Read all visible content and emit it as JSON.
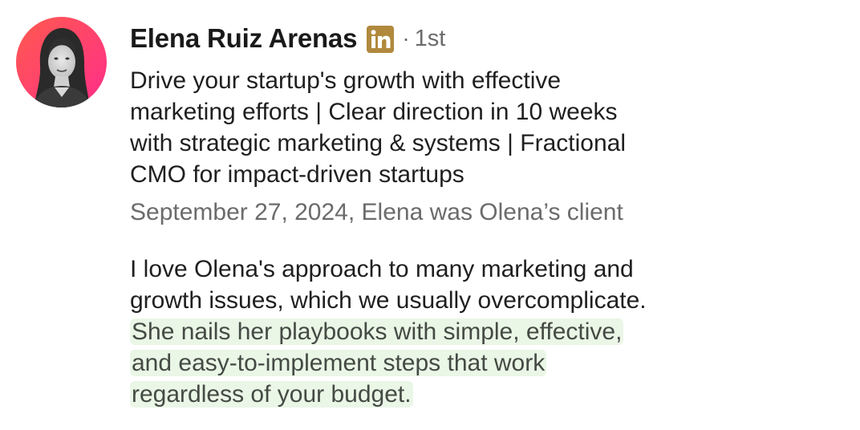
{
  "profile": {
    "name": "Elena Ruiz Arenas",
    "badge_icon": "linkedin-logo-icon",
    "badge_color": "#b0893d",
    "separator": "·",
    "degree": "1st",
    "headline_lines": [
      "Drive your startup's growth with effective",
      "marketing efforts | Clear direction in 10 weeks",
      "with strategic marketing & systems | Fractional",
      "CMO for impact-driven startups"
    ],
    "meta": "September 27, 2024, Elena was Olena’s client"
  },
  "recommendation": {
    "text_plain_lines": [
      "I love Olena's approach to many marketing and",
      "growth issues, which we usually overcomplicate."
    ],
    "text_highlight_lines": [
      "She nails her playbooks with simple, effective,",
      "and easy-to-implement steps that work",
      "regardless of your budget."
    ],
    "highlight_color": "#eaf6e6"
  },
  "colors": {
    "avatar_gradient_start": "#ff5a5f",
    "avatar_gradient_end": "#ff2d8a",
    "secondary_text": "#6b6b6b",
    "primary_text": "#1f1f1f"
  }
}
